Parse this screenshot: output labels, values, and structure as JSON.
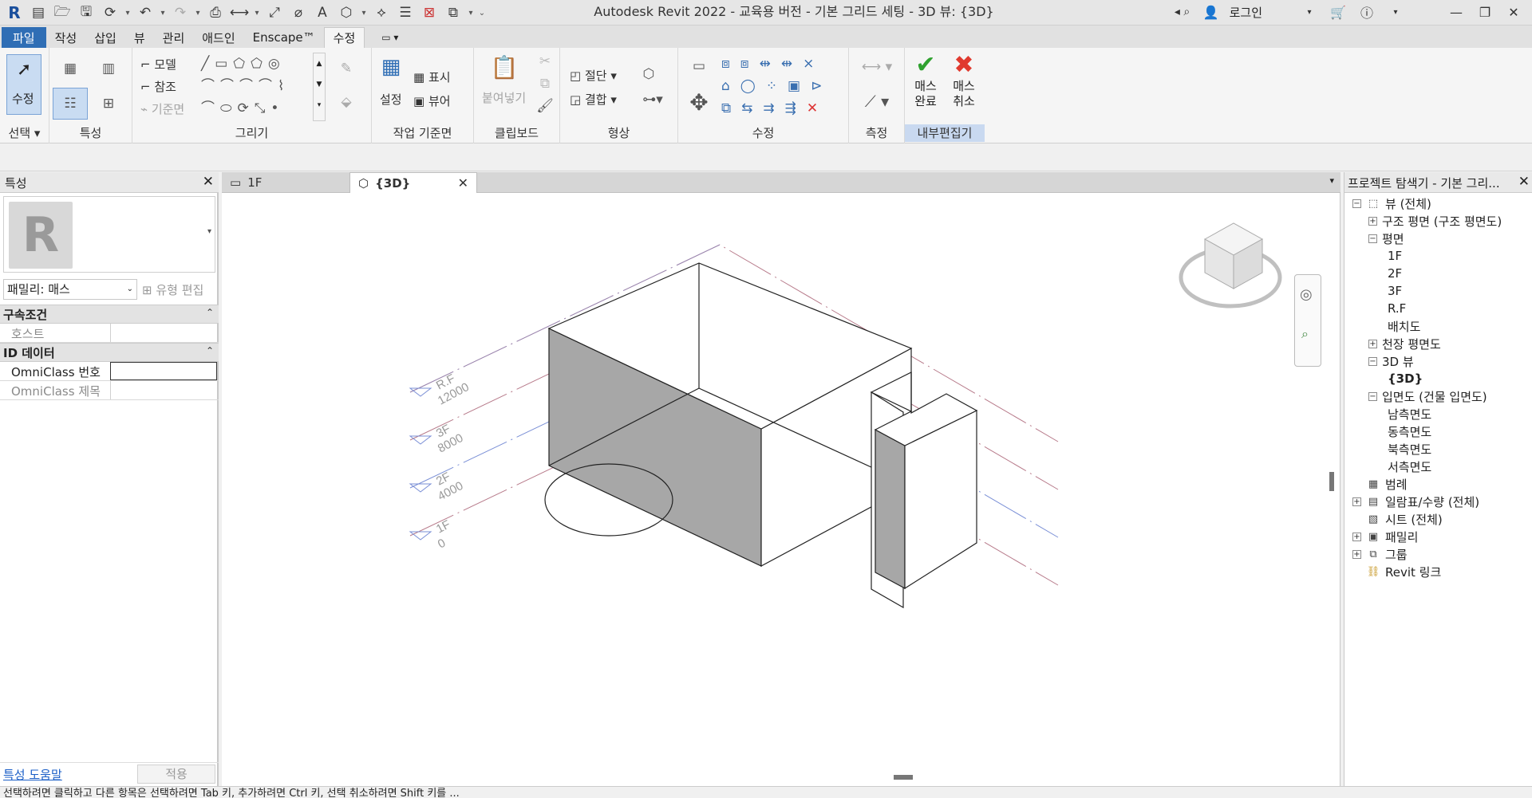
{
  "app": {
    "title": "Autodesk Revit 2022 - 교육용 버전 - 기본 그리드 세팅 - 3D 뷰: {3D}",
    "login_label": "로그인"
  },
  "ribbon": {
    "tabs": [
      "파일",
      "작성",
      "삽입",
      "뷰",
      "관리",
      "애드인",
      "Enscape™",
      "수정"
    ],
    "active_tab": "수정",
    "panels": {
      "select": {
        "label": "선택",
        "modify_label": "수정"
      },
      "properties": {
        "label": "특성"
      },
      "draw": {
        "label": "그리기",
        "model": "모델",
        "reference": "참조",
        "ref_plane": "기준면"
      },
      "work_plane": {
        "label": "작업 기준면",
        "set": "설정",
        "show": "표시",
        "viewer": "뷰어"
      },
      "clipboard": {
        "label": "클립보드",
        "paste": "붙여넣기"
      },
      "geometry": {
        "label": "형상",
        "cut": "절단",
        "join": "결합"
      },
      "modify": {
        "label": "수정"
      },
      "measure": {
        "label": "측정"
      },
      "in_place_editor": {
        "label": "내부편집기",
        "finish": "매스\n완료",
        "cancel": "매스\n취소"
      }
    }
  },
  "properties": {
    "title": "특성",
    "family": "패밀리: 매스",
    "edit_type": "유형 편집",
    "categories": [
      {
        "name": "구속조건",
        "rows": [
          {
            "name": "호스트",
            "value": ""
          }
        ]
      },
      {
        "name": "ID 데이터",
        "rows": [
          {
            "name": "OmniClass 번호",
            "value": ""
          },
          {
            "name": "OmniClass 제목",
            "value": ""
          }
        ]
      }
    ],
    "help_link": "특성 도움말",
    "apply": "적용"
  },
  "view_tabs": [
    {
      "label": "1F",
      "active": false
    },
    {
      "label": "{3D}",
      "active": true
    }
  ],
  "viewport": {
    "levels": [
      {
        "name": "R.F",
        "elevation": "12000"
      },
      {
        "name": "3F",
        "elevation": "8000"
      },
      {
        "name": "2F",
        "elevation": "4000"
      },
      {
        "name": "1F",
        "elevation": "0"
      }
    ]
  },
  "browser": {
    "title": "프로젝트 탐색기 - 기본 그리...",
    "tree": [
      {
        "label": "뷰 (전체)",
        "level": 0,
        "toggle": "−",
        "icon": "views-icon"
      },
      {
        "label": "구조 평면 (구조 평면도)",
        "level": 1,
        "toggle": "+"
      },
      {
        "label": "평면",
        "level": 1,
        "toggle": "−"
      },
      {
        "label": "1F",
        "level": 2
      },
      {
        "label": "2F",
        "level": 2
      },
      {
        "label": "3F",
        "level": 2
      },
      {
        "label": "R.F",
        "level": 2
      },
      {
        "label": "배치도",
        "level": 2
      },
      {
        "label": "천장 평면도",
        "level": 1,
        "toggle": "+"
      },
      {
        "label": "3D 뷰",
        "level": 1,
        "toggle": "−"
      },
      {
        "label": "{3D}",
        "level": 2,
        "bold": true
      },
      {
        "label": "입면도 (건물 입면도)",
        "level": 1,
        "toggle": "−"
      },
      {
        "label": "남측면도",
        "level": 2
      },
      {
        "label": "동측면도",
        "level": 2
      },
      {
        "label": "북측면도",
        "level": 2
      },
      {
        "label": "서측면도",
        "level": 2
      },
      {
        "label": "범례",
        "level": 0,
        "icon": "legend-icon"
      },
      {
        "label": "일람표/수량 (전체)",
        "level": 0,
        "toggle": "+",
        "icon": "schedule-icon"
      },
      {
        "label": "시트 (전체)",
        "level": 0,
        "icon": "sheet-icon"
      },
      {
        "label": "패밀리",
        "level": 0,
        "toggle": "+",
        "icon": "family-icon"
      },
      {
        "label": "그룹",
        "level": 0,
        "toggle": "+",
        "icon": "group-icon"
      },
      {
        "label": "Revit 링크",
        "level": 0,
        "icon": "link-icon"
      }
    ]
  },
  "status": {
    "text": "선택하려면 클릭하고 다른 항목은 선택하려면 Tab 키, 추가하려면 Ctrl 키, 선택 취소하려면 Shift 키를 ..."
  },
  "colors": {
    "file_tab": "#2f6eb5",
    "finish_check": "#2fa12f",
    "cancel_x": "#e03a2f",
    "level_line": "#b77a8a",
    "grid_line": "#7a8fd6",
    "shade": "#a7a7a7"
  }
}
